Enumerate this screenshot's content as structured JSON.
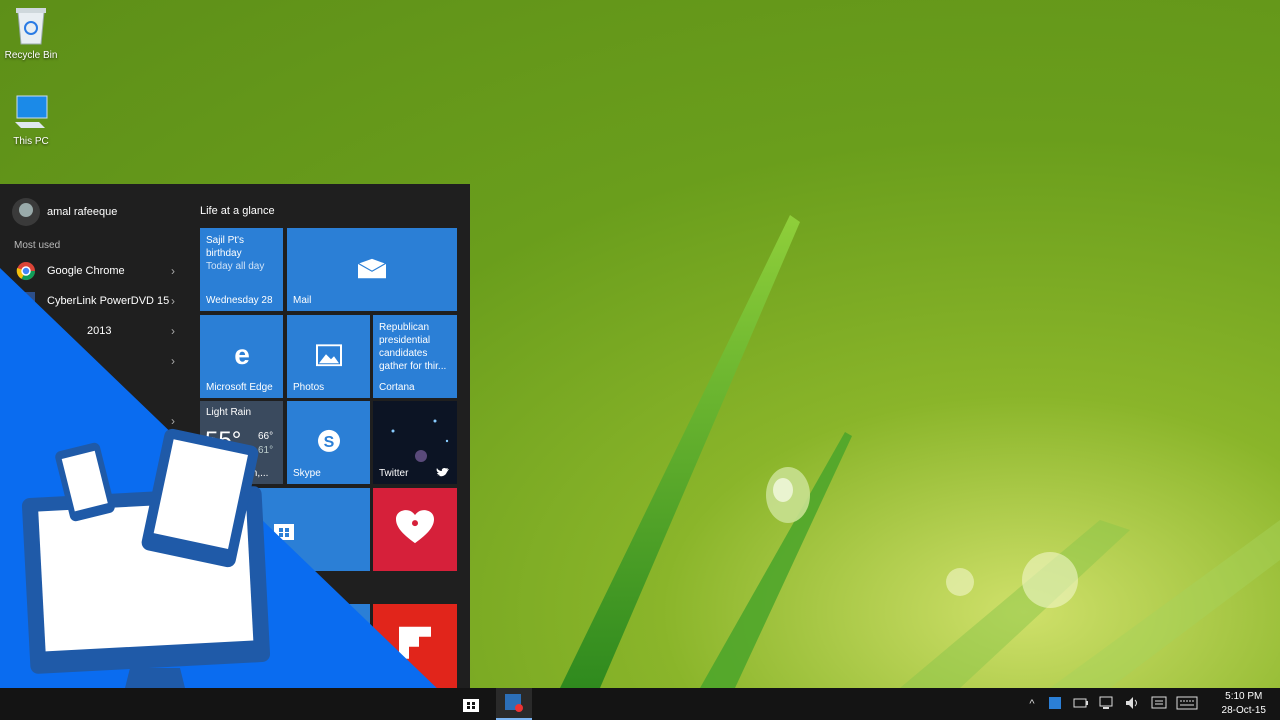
{
  "desktop": {
    "icons": [
      {
        "label": "Recycle Bin"
      },
      {
        "label": "This PC"
      }
    ]
  },
  "start_menu": {
    "user_name": "amal rafeeque",
    "most_used_label": "Most used",
    "apps": [
      {
        "label": "Google Chrome",
        "icon": "chrome-icon"
      },
      {
        "label": "CyberLink PowerDVD 15",
        "icon": "powerdvd-icon"
      },
      {
        "label": "2013",
        "icon": "office-icon"
      }
    ],
    "group_title": "Life at a glance",
    "tiles": {
      "calendar": {
        "line1": "Sajil Pt's",
        "line2": "birthday",
        "line3": "Today all day",
        "label": "Wednesday 28"
      },
      "mail": {
        "label": "Mail"
      },
      "edge": {
        "label": "Microsoft Edge"
      },
      "photos": {
        "label": "Photos"
      },
      "cortana": {
        "text": "Republican presidential candidates gather for thir...",
        "label": "Cortana"
      },
      "weather": {
        "title": "Light Rain",
        "temp": "55°",
        "high": "66°",
        "low": "61°",
        "place": "ion,..."
      },
      "skype": {
        "label": "Skype"
      },
      "twitter": {
        "label": "Twitter"
      }
    }
  },
  "taskbar": {
    "time": "5:10 PM",
    "date": "28-Oct-15"
  },
  "colors": {
    "tile_blue": "#2b7fd6",
    "overlay_blue": "#0a6cf0",
    "iheart_red": "#d6203a",
    "flipboard_red": "#e1251b"
  }
}
